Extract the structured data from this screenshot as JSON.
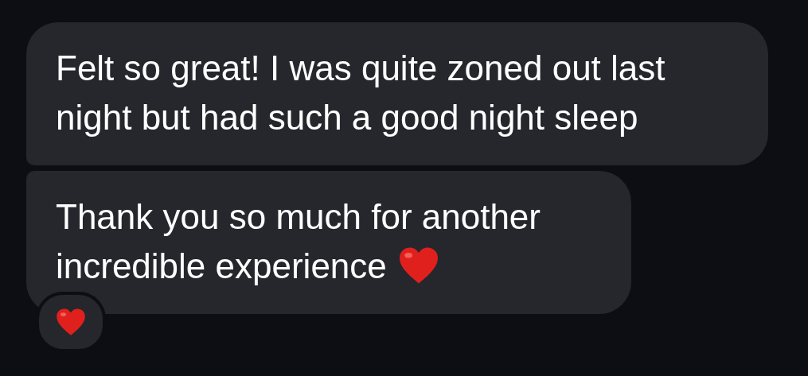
{
  "messages": [
    {
      "text": "Felt so great! I was quite zoned out last night but had such a good night sleep",
      "ends_with_heart": false,
      "reaction": false
    },
    {
      "text": "Thank you so much for another incredible experience",
      "ends_with_heart": true,
      "reaction": true
    }
  ]
}
